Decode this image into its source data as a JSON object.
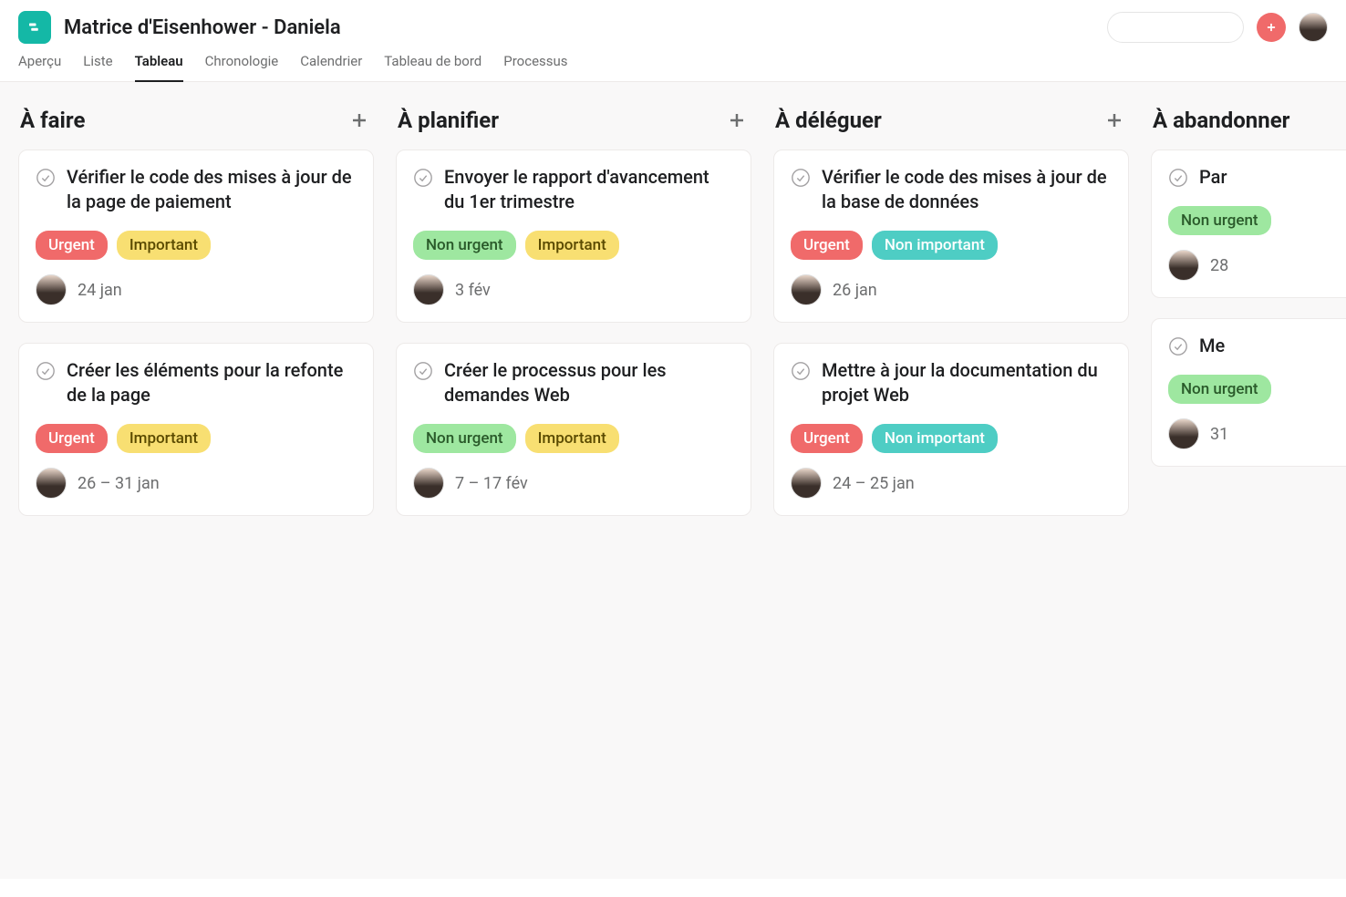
{
  "project_title": "Matrice d'Eisenhower - Daniela",
  "search_placeholder": "",
  "tabs": [
    {
      "label": "Aperçu",
      "active": false
    },
    {
      "label": "Liste",
      "active": false
    },
    {
      "label": "Tableau",
      "active": true
    },
    {
      "label": "Chronologie",
      "active": false
    },
    {
      "label": "Calendrier",
      "active": false
    },
    {
      "label": "Tableau de bord",
      "active": false
    },
    {
      "label": "Processus",
      "active": false
    }
  ],
  "tag_labels": {
    "urgent": "Urgent",
    "important": "Important",
    "nonurgent": "Non urgent",
    "nonimportant": "Non important"
  },
  "columns": [
    {
      "title": "À faire",
      "cards": [
        {
          "title": "Vérifier le code des mises à jour de la page de paiement",
          "tags": [
            "urgent",
            "important"
          ],
          "due": "24 jan"
        },
        {
          "title": "Créer les éléments pour la refonte de la page",
          "tags": [
            "urgent",
            "important"
          ],
          "due": "26 – 31 jan"
        }
      ]
    },
    {
      "title": "À planifier",
      "cards": [
        {
          "title": "Envoyer le rapport d'avancement du 1er trimestre",
          "tags": [
            "nonurgent",
            "important"
          ],
          "due": "3 fév"
        },
        {
          "title": "Créer le processus pour les demandes Web",
          "tags": [
            "nonurgent",
            "important"
          ],
          "due": "7 – 17 fév"
        }
      ]
    },
    {
      "title": "À déléguer",
      "cards": [
        {
          "title": "Vérifier le code des mises à jour de la base de données",
          "tags": [
            "urgent",
            "nonimportant"
          ],
          "due": "26 jan"
        },
        {
          "title": "Mettre à jour la documentation du projet Web",
          "tags": [
            "urgent",
            "nonimportant"
          ],
          "due": "24 – 25 jan"
        }
      ]
    },
    {
      "title": "À abandonner",
      "cards": [
        {
          "title": "Par",
          "tags": [
            "nonurgent"
          ],
          "due": "28"
        },
        {
          "title": "Me",
          "tags": [
            "nonurgent"
          ],
          "due": "31"
        }
      ]
    }
  ]
}
